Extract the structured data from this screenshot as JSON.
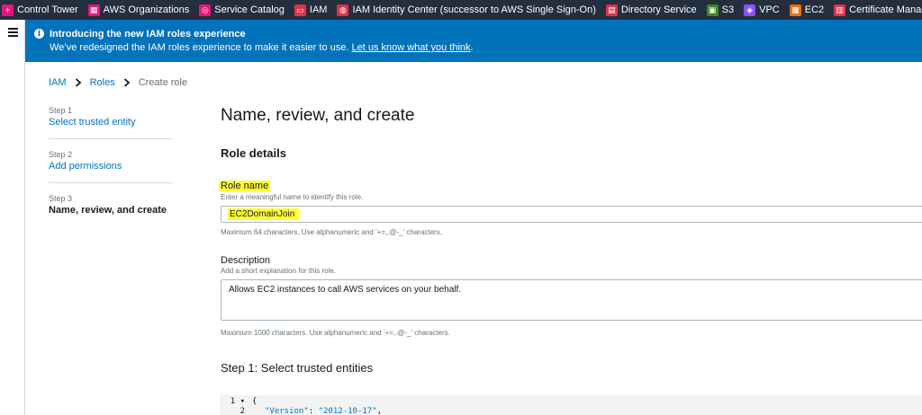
{
  "favorites": [
    {
      "label": "Control Tower",
      "icon": "control-tower-icon",
      "color": "#e7157b",
      "glyph": "+"
    },
    {
      "label": "AWS Organizations",
      "icon": "organizations-icon",
      "color": "#e7157b",
      "glyph": "▦"
    },
    {
      "label": "Service Catalog",
      "icon": "service-catalog-icon",
      "color": "#e7157b",
      "glyph": "◎"
    },
    {
      "label": "IAM",
      "icon": "iam-icon",
      "color": "#dd344c",
      "glyph": "▭"
    },
    {
      "label": "IAM Identity Center (successor to AWS Single Sign-On)",
      "icon": "identity-center-icon",
      "color": "#dd344c",
      "glyph": "◍"
    },
    {
      "label": "Directory Service",
      "icon": "directory-service-icon",
      "color": "#dd344c",
      "glyph": "▤"
    },
    {
      "label": "S3",
      "icon": "s3-icon",
      "color": "#3f8624",
      "glyph": "▣"
    },
    {
      "label": "VPC",
      "icon": "vpc-icon",
      "color": "#8c4fff",
      "glyph": "◈"
    },
    {
      "label": "EC2",
      "icon": "ec2-icon",
      "color": "#ed7100",
      "glyph": "▩"
    },
    {
      "label": "Certificate Manager",
      "icon": "certificate-manager-icon",
      "color": "#dd344c",
      "glyph": "▥"
    }
  ],
  "banner": {
    "title": "Introducing the new IAM roles experience",
    "text": "We’ve redesigned the IAM roles experience to make it easier to use. ",
    "link": "Let us know what you think",
    "link_suffix": "."
  },
  "breadcrumb": {
    "items": [
      "IAM",
      "Roles"
    ],
    "current": "Create role"
  },
  "steps": [
    {
      "number": "Step 1",
      "label": "Select trusted entity"
    },
    {
      "number": "Step 2",
      "label": "Add permissions"
    },
    {
      "number": "Step 3",
      "label": "Name, review, and create"
    }
  ],
  "main": {
    "title": "Name, review, and create",
    "section": "Role details",
    "role_name": {
      "label": "Role name",
      "description": "Enter a meaningful name to identify this role.",
      "value": "EC2DomainJoin",
      "hint": "Maximum 64 characters. Use alphanumeric and '+=,.@-_' characters."
    },
    "description": {
      "label": "Description",
      "description": "Add a short explanation for this role.",
      "value": "Allows EC2 instances to call AWS services on your behalf.",
      "hint": "Maximum 1000 characters. Use alphanumeric and '+=,.@-_' characters."
    },
    "trusted_heading": "Step 1: Select trusted entities",
    "code": {
      "lines": [
        {
          "num": "1 ▾",
          "text": "{"
        },
        {
          "num": "2",
          "key": "\"Version\"",
          "sep": ": ",
          "val": "\"2012-10-17\"",
          "end": ","
        }
      ]
    }
  },
  "colors": {
    "nav_bg": "#232f3e",
    "banner_bg": "#0073bb",
    "link": "#0073bb",
    "highlight": "#ffff33"
  }
}
